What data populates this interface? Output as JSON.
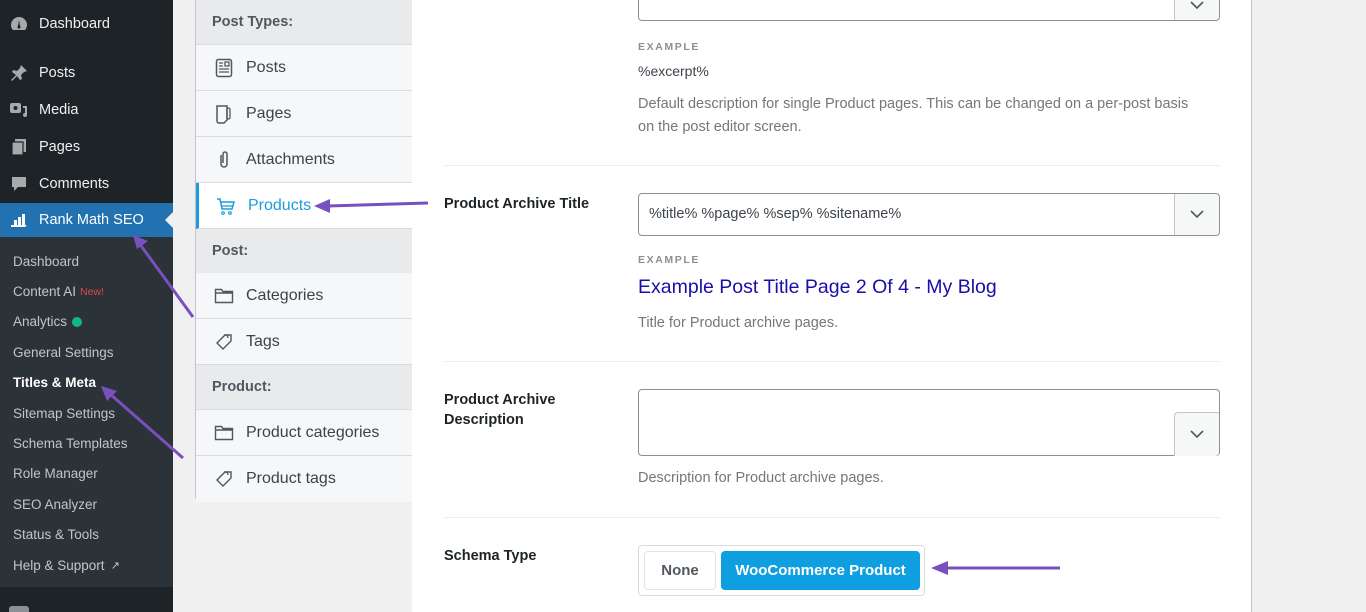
{
  "wp_menu": {
    "items": [
      {
        "label": "Dashboard",
        "icon": "dashboard-icon"
      },
      {
        "label": "Posts",
        "icon": "pin-icon"
      },
      {
        "label": "Media",
        "icon": "media-icon"
      },
      {
        "label": "Pages",
        "icon": "pages-icon"
      },
      {
        "label": "Comments",
        "icon": "comment-icon"
      },
      {
        "label": "Rank Math SEO",
        "icon": "rank-math-icon",
        "active": true
      }
    ],
    "submenu": [
      {
        "label": "Dashboard"
      },
      {
        "label": "Content AI",
        "badge": "New!"
      },
      {
        "label": "Analytics",
        "status_dot": "green"
      },
      {
        "label": "General Settings"
      },
      {
        "label": "Titles & Meta",
        "current": true
      },
      {
        "label": "Sitemap Settings"
      },
      {
        "label": "Schema Templates"
      },
      {
        "label": "Role Manager"
      },
      {
        "label": "SEO Analyzer"
      },
      {
        "label": "Status & Tools"
      },
      {
        "label": "Help & Support",
        "external": true
      }
    ]
  },
  "settings_nav": {
    "groups": [
      {
        "heading": "Post Types:",
        "items": [
          {
            "label": "Posts",
            "icon": "post-icon"
          },
          {
            "label": "Pages",
            "icon": "page-icon"
          },
          {
            "label": "Attachments",
            "icon": "paperclip-icon"
          },
          {
            "label": "Products",
            "icon": "cart-icon",
            "active": true
          }
        ]
      },
      {
        "heading": "Post:",
        "items": [
          {
            "label": "Categories",
            "icon": "folder-icon"
          },
          {
            "label": "Tags",
            "icon": "tag-icon"
          }
        ]
      },
      {
        "heading": "Product:",
        "items": [
          {
            "label": "Product categories",
            "icon": "folder-icon"
          },
          {
            "label": "Product tags",
            "icon": "tag-icon"
          }
        ]
      }
    ]
  },
  "panel": {
    "single_description": {
      "example_label": "EXAMPLE",
      "example_value": "%excerpt%",
      "help": "Default description for single Product pages. This can be changed on a per-post basis on the post editor screen."
    },
    "archive_title": {
      "label": "Product Archive Title",
      "value": "%title% %page% %sep% %sitename%",
      "example_label": "EXAMPLE",
      "example_value": "Example Post Title Page 2 Of 4 - My Blog",
      "help": "Title for Product archive pages."
    },
    "archive_description": {
      "label": "Product Archive Description",
      "value": "",
      "help": "Description for Product archive pages."
    },
    "schema_type": {
      "label": "Schema Type",
      "options": [
        "None",
        "WooCommerce Product"
      ],
      "selected": "WooCommerce Product"
    }
  },
  "colors": {
    "wp_active": "#2271b1",
    "rank_math_blue": "#0f9fe0",
    "annotation_arrow": "#7a4fbf",
    "example_link": "#1a0dab"
  }
}
